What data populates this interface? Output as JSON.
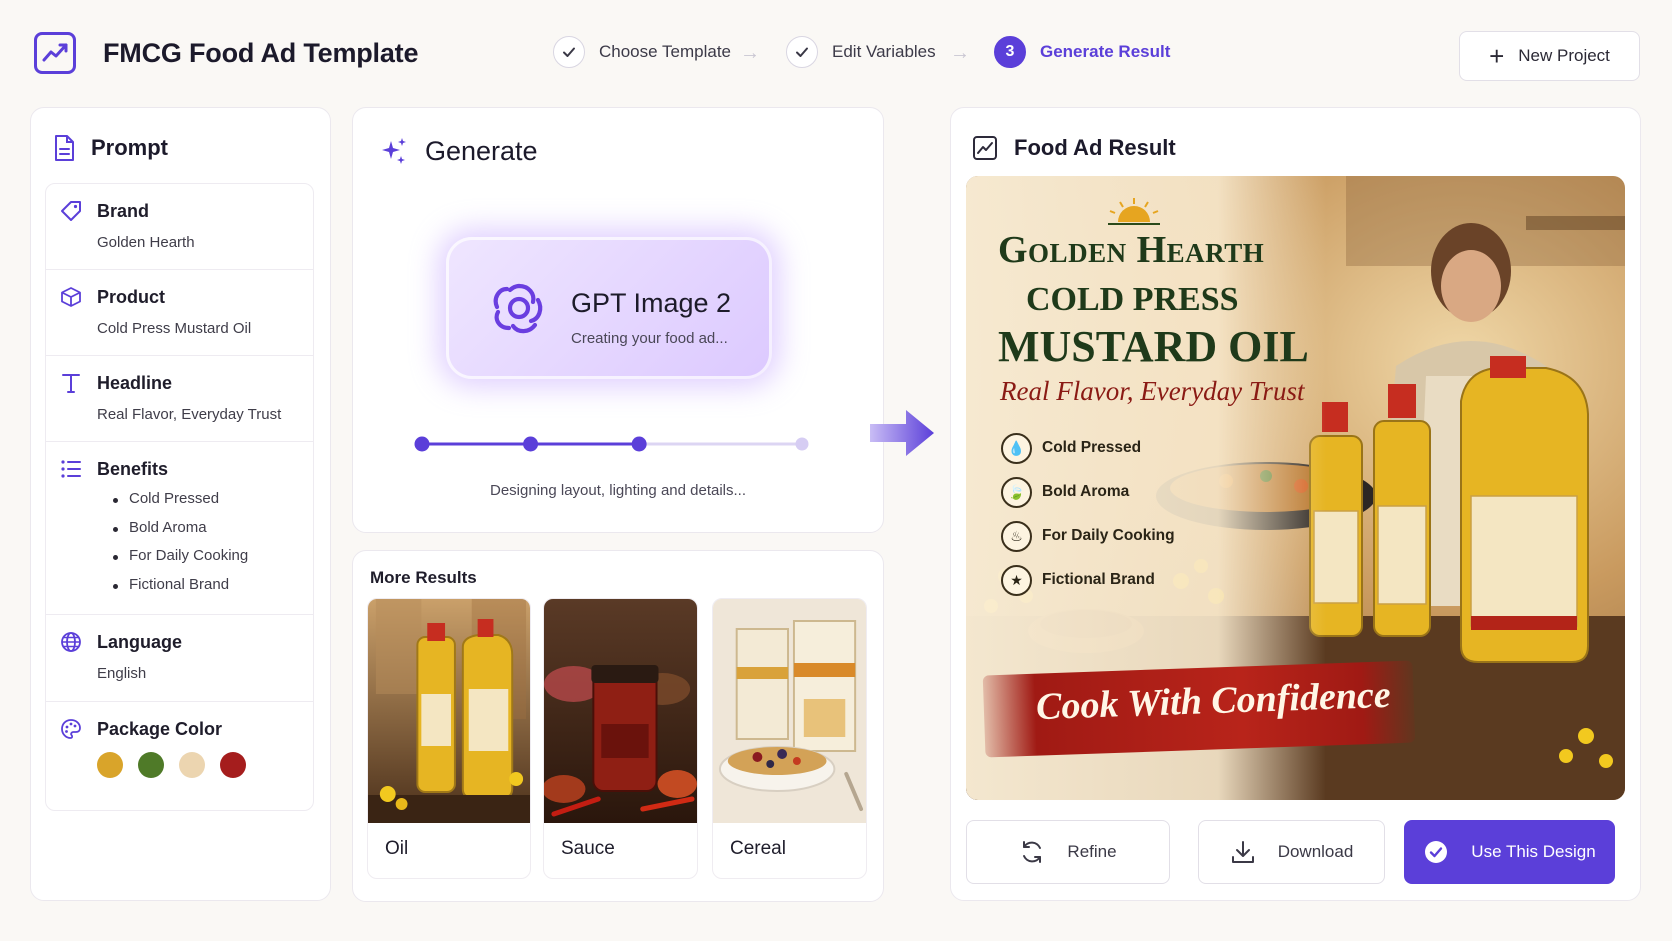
{
  "header": {
    "title": "FMCG Food Ad Template",
    "steps": [
      {
        "label": "Choose Template",
        "state": "done"
      },
      {
        "label": "Edit Variables",
        "state": "done"
      },
      {
        "label": "Generate Result",
        "state": "active",
        "number": "3"
      }
    ],
    "new_project_label": "New Project"
  },
  "prompt": {
    "title": "Prompt",
    "brand": {
      "label": "Brand",
      "value": "Golden Hearth"
    },
    "product": {
      "label": "Product",
      "value": "Cold Press Mustard Oil"
    },
    "headline": {
      "label": "Headline",
      "value": "Real Flavor, Everyday Trust"
    },
    "benefits": {
      "label": "Benefits",
      "items": [
        "Cold Pressed",
        "Bold Aroma",
        "For Daily Cooking",
        "Fictional Brand"
      ]
    },
    "language": {
      "label": "Language",
      "value": "English"
    },
    "package_color": {
      "label": "Package Color",
      "colors": [
        "#d9a42a",
        "#4f7a28",
        "#ecd5b0",
        "#a51d1d"
      ]
    }
  },
  "generate": {
    "title": "Generate",
    "model_name": "GPT Image 2",
    "model_status": "Creating your food ad...",
    "progress_steps_done": 3,
    "progress_steps_total": 4,
    "caption": "Designing layout, lighting and details..."
  },
  "more_results": {
    "title": "More Results",
    "items": [
      {
        "label": "Oil"
      },
      {
        "label": "Sauce"
      },
      {
        "label": "Cereal"
      }
    ]
  },
  "result": {
    "title": "Food Ad Result",
    "ad": {
      "brand": "Golden Hearth",
      "product_line1": "COLD PRESS",
      "product_line2": "MUSTARD OIL",
      "tagline": "Real Flavor, Everyday Trust",
      "benefits": [
        "Cold Pressed",
        "Bold Aroma",
        "For Daily Cooking",
        "Fictional Brand"
      ],
      "banner": "Cook With Confidence"
    },
    "actions": {
      "refine": "Refine",
      "download": "Download",
      "use": "Use This Design"
    }
  },
  "colors": {
    "accent": "#5b3fd9",
    "background": "#faf8f5"
  }
}
